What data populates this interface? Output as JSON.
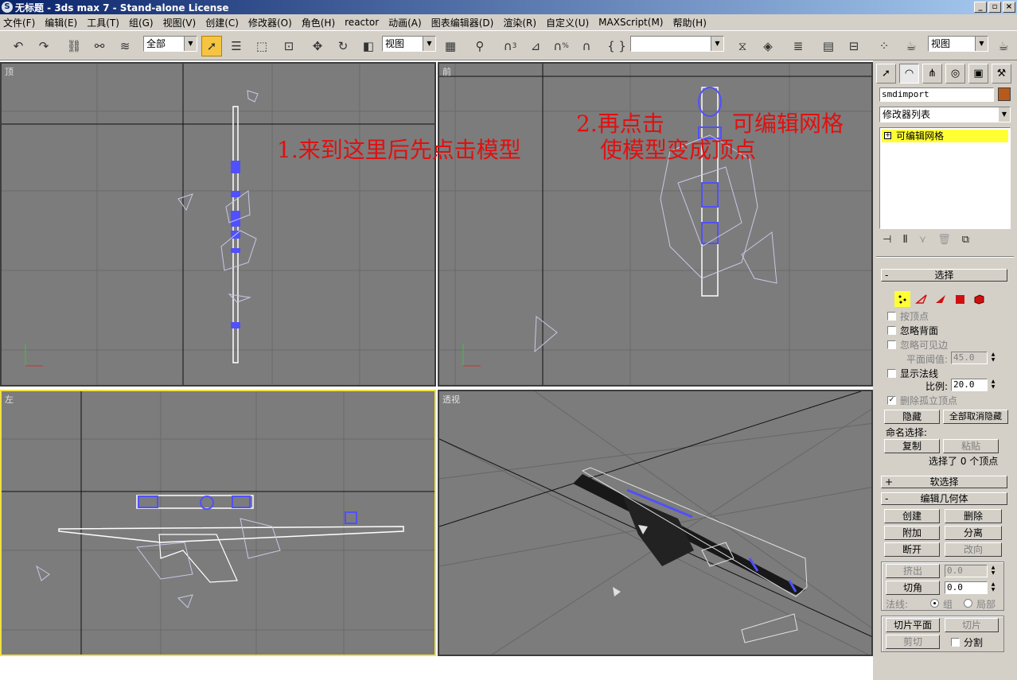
{
  "window": {
    "title": "无标题 - 3ds max 7 - Stand-alone License",
    "buttons": [
      "_",
      "▫",
      "×"
    ]
  },
  "menu": [
    "文件(F)",
    "编辑(E)",
    "工具(T)",
    "组(G)",
    "视图(V)",
    "创建(C)",
    "修改器(O)",
    "角色(H)",
    "reactor",
    "动画(A)",
    "图表编辑器(D)",
    "渲染(R)",
    "自定义(U)",
    "MAXScript(M)",
    "帮助(H)"
  ],
  "toolbar": {
    "selection_filter": "全部",
    "ref_coord": "视图",
    "named_selection": "",
    "render_type": "视图",
    "snap_label": "3",
    "percent_snap_label": "%"
  },
  "viewports": {
    "top": {
      "label": "顶"
    },
    "front": {
      "label": "前"
    },
    "left": {
      "label": "左"
    },
    "perspective": {
      "label": "透视"
    }
  },
  "annotations": {
    "step1": "1.来到这里后先点击模型",
    "step2_line1": "2.再点击",
    "step2_line1b": "可编辑网格",
    "step2_line2": "使模型变成顶点"
  },
  "command_panel": {
    "object_name": "smdimport",
    "modifier_list": "修改器列表",
    "stack_item": "可编辑网格",
    "selection_rollout": {
      "title": "选择",
      "by_vertex": "按顶点",
      "ignore_backfacing": "忽略背面",
      "ignore_visible_edges": "忽略可见边",
      "planar_thresh_label": "平面阈值:",
      "planar_thresh_value": "45.0",
      "show_normals": "显示法线",
      "scale_label": "比例:",
      "scale_value": "20.0",
      "delete_isolated": "删除孤立顶点",
      "hide_btn": "隐藏",
      "unhide_all_btn": "全部取消隐藏",
      "named_sel_label": "命名选择:",
      "copy_btn": "复制",
      "paste_btn": "粘贴",
      "selection_status": "选择了 0 个顶点"
    },
    "soft_selection": {
      "title": "软选择"
    },
    "edit_geometry": {
      "title": "编辑几何体",
      "create": "创建",
      "delete": "删除",
      "attach": "附加",
      "detach": "分离",
      "break": "断开",
      "turn": "改向",
      "extrude": "挤出",
      "extrude_value": "0.0",
      "chamfer": "切角",
      "chamfer_value": "0.0",
      "normal_label": "法线:",
      "group_label": "组",
      "local_label": "局部",
      "slice_plane": "切片平面",
      "slice": "切片",
      "cut": "剪切",
      "split": "分割"
    }
  },
  "colors": {
    "viewport_bg": "#7c7c7c",
    "active_viewport_border": "#f0e040",
    "annotation": "#e01010",
    "selected_stack": "#ffff33",
    "object_color": "#b85a1c"
  }
}
